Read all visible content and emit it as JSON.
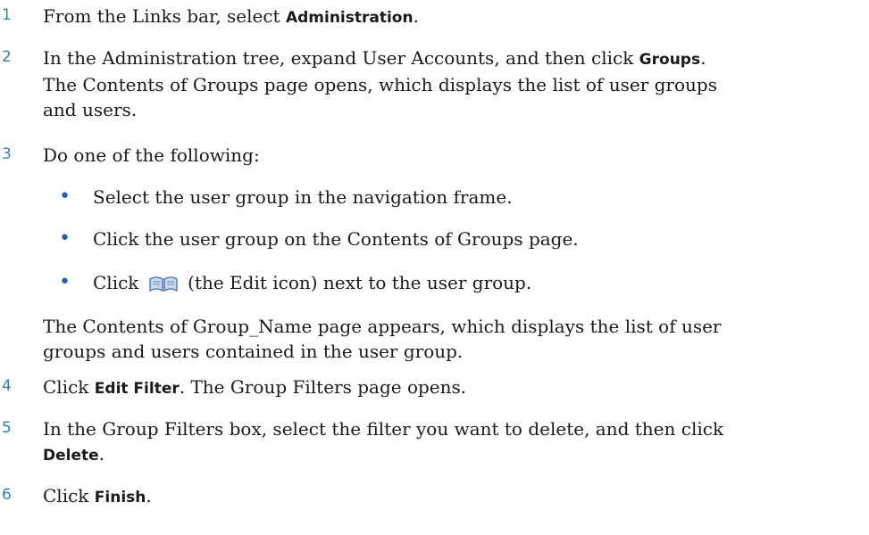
{
  "steps": [
    {
      "number": "1",
      "prefix": "From the Links bar, select ",
      "ui": "Administration",
      "suffix": "."
    },
    {
      "number": "2",
      "prefix": "In the Administration tree, expand User Accounts, and then click ",
      "ui": "Groups",
      "suffix": ".",
      "line2": "The Contents of Groups page opens, which displays the list of user groups",
      "line3": "and users."
    },
    {
      "number": "3",
      "text": "Do one of the following:",
      "bullets": [
        "Select the user group in the navigation frame.",
        "Click the user group on the Contents of Groups page."
      ],
      "icon_bullet": {
        "prefix": "Click ",
        "icon": "edit-book-icon",
        "suffix": " (the Edit icon) next to the user group."
      },
      "after_line1": "The Contents of Group_Name page appears, which displays the list of user",
      "after_line2": "groups and users contained in the user group."
    },
    {
      "number": "4",
      "prefix": "Click ",
      "ui": "Edit Filter",
      "suffix": ". The Group Filters page opens."
    },
    {
      "number": "5",
      "line1": "In the Group Filters box, select the filter you want to delete, and then click",
      "ui": "Delete",
      "suffix": "."
    },
    {
      "number": "6",
      "prefix": "Click ",
      "ui": "Finish",
      "suffix": "."
    }
  ],
  "colors": {
    "step_number": "#2f7fb8",
    "bullet": "#1f5fb5",
    "text": "#1a1a1a"
  }
}
